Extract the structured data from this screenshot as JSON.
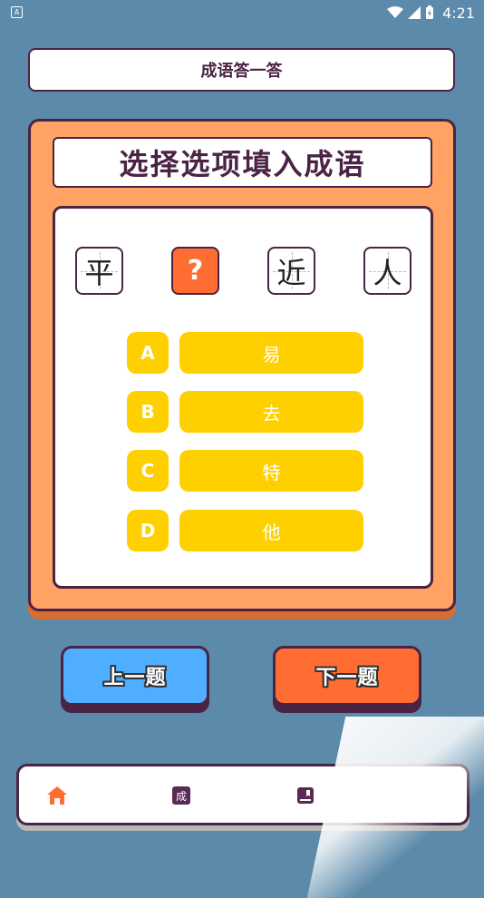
{
  "status_bar": {
    "time": "4:21",
    "app_icon": "A"
  },
  "header": {
    "title": "成语答一答"
  },
  "card": {
    "title": "选择选项填入成语",
    "idiom": [
      {
        "char": "平",
        "blank": false
      },
      {
        "char": "?",
        "blank": true
      },
      {
        "char": "近",
        "blank": false
      },
      {
        "char": "人",
        "blank": false
      }
    ],
    "options": [
      {
        "letter": "A",
        "text": "易"
      },
      {
        "letter": "B",
        "text": "去"
      },
      {
        "letter": "C",
        "text": "特"
      },
      {
        "letter": "D",
        "text": "他"
      }
    ]
  },
  "buttons": {
    "prev": "上一题",
    "next": "下一题"
  },
  "nav": {
    "items": [
      {
        "icon": "home-icon",
        "color": "#ff6d33",
        "active": true
      },
      {
        "icon": "idiom-icon",
        "label": "成",
        "color": "#5a2a55"
      },
      {
        "icon": "book-icon",
        "color": "#5a2a55"
      }
    ]
  },
  "colors": {
    "background": "#5b8aaa",
    "card": "#ffa264",
    "option": "#ffd000",
    "accent": "#ff6d33",
    "prev_button": "#4faeff",
    "outline": "#4a2345"
  }
}
